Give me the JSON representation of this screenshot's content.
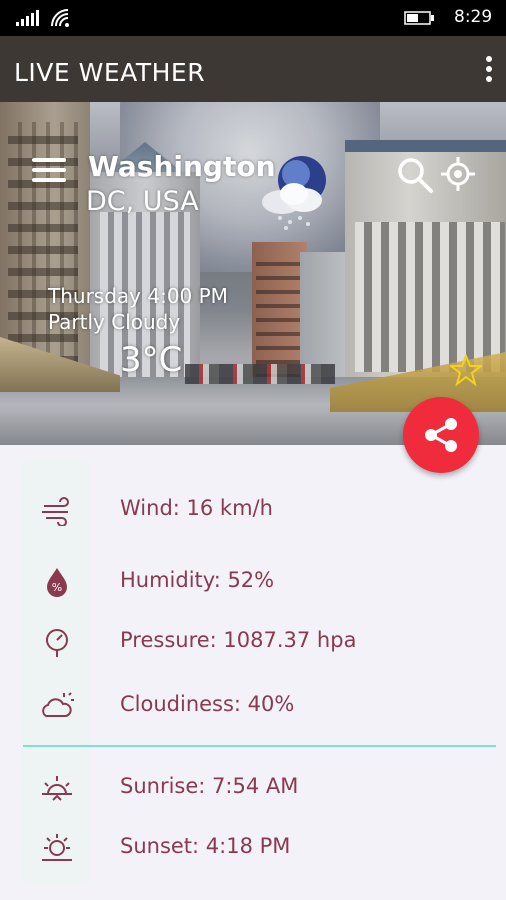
{
  "status_bar": {
    "time": "8:29"
  },
  "app_bar": {
    "title": "LIVE WEATHER"
  },
  "location": {
    "city": "Washington",
    "region": "DC, USA"
  },
  "current": {
    "datetime": "Thursday 4:00 PM",
    "condition": "Partly Cloudy",
    "temperature": "3°C"
  },
  "details": {
    "wind": "Wind: 16 km/h",
    "humidity": "Humidity: 52%",
    "pressure": "Pressure: 1087.37 hpa",
    "cloudiness": "Cloudiness: 40%",
    "sunrise": "Sunrise: 7:54 AM",
    "sunset": "Sunset: 4:18 PM"
  },
  "colors": {
    "app_bar": "#3e3834",
    "fab": "#ef2b3c",
    "label_text": "#8a3a4e",
    "divider": "#7ee0cf"
  },
  "icons": [
    "signal-icon",
    "wifi-icon",
    "battery-icon",
    "overflow-menu-icon",
    "menu-icon",
    "weather-condition-icon",
    "search-icon",
    "location-icon",
    "star-icon",
    "share-icon",
    "wind-icon",
    "humidity-icon",
    "pressure-icon",
    "cloudiness-icon",
    "sunrise-icon",
    "sunset-icon"
  ]
}
